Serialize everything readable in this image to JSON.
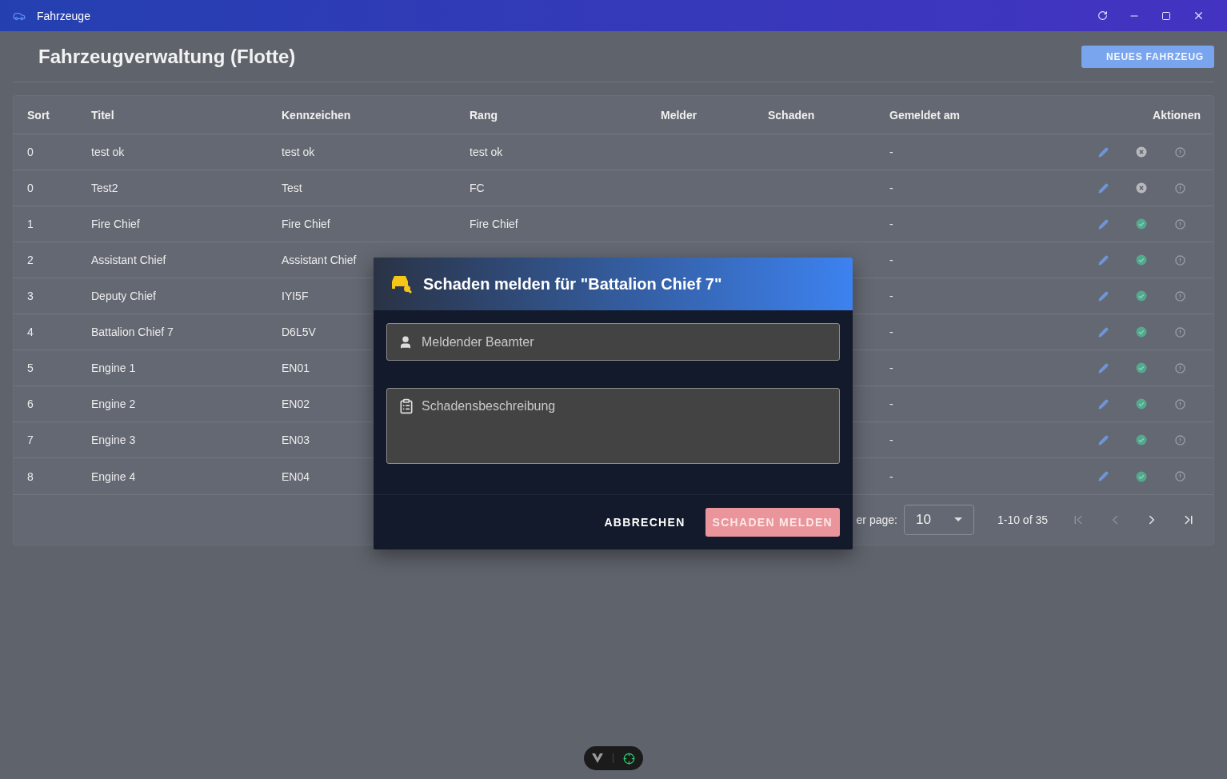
{
  "window": {
    "title": "Fahrzeuge"
  },
  "page": {
    "heading": "Fahrzeugverwaltung (Flotte)",
    "new_button": "NEUES FAHRZEUG"
  },
  "table": {
    "columns": [
      "Sort",
      "Titel",
      "Kennzeichen",
      "Rang",
      "Melder",
      "Schaden",
      "Gemeldet am",
      "Aktionen"
    ],
    "rows": [
      {
        "sort": "0",
        "titel": "test ok",
        "kennzeichen": "test ok",
        "rang": "test ok",
        "gemeldet_am": "-",
        "active": false
      },
      {
        "sort": "0",
        "titel": "Test2",
        "kennzeichen": "Test",
        "rang": "FC",
        "gemeldet_am": "-",
        "active": false
      },
      {
        "sort": "1",
        "titel": "Fire Chief",
        "kennzeichen": "Fire Chief",
        "rang": "Fire Chief",
        "gemeldet_am": "-",
        "active": true
      },
      {
        "sort": "2",
        "titel": "Assistant Chief",
        "kennzeichen": "Assistant Chief",
        "gemeldet_am": "-",
        "active": true
      },
      {
        "sort": "3",
        "titel": "Deputy Chief",
        "kennzeichen": "IYI5F",
        "gemeldet_am": "-",
        "active": true
      },
      {
        "sort": "4",
        "titel": "Battalion Chief 7",
        "kennzeichen": "D6L5V",
        "gemeldet_am": "-",
        "active": true
      },
      {
        "sort": "5",
        "titel": "Engine 1",
        "kennzeichen": "EN01",
        "gemeldet_am": "-",
        "active": true
      },
      {
        "sort": "6",
        "titel": "Engine 2",
        "kennzeichen": "EN02",
        "gemeldet_am": "-",
        "active": true
      },
      {
        "sort": "7",
        "titel": "Engine 3",
        "kennzeichen": "EN03",
        "gemeldet_am": "-",
        "active": true
      },
      {
        "sort": "8",
        "titel": "Engine 4",
        "kennzeichen": "EN04",
        "gemeldet_am": "-",
        "active": true
      }
    ]
  },
  "pagination": {
    "rows_per_page_label": "er page:",
    "rows_per_page": "10",
    "range": "1-10 of 35",
    "first_disabled": true,
    "prev_disabled": true,
    "next_disabled": false,
    "last_disabled": false
  },
  "dialog": {
    "title": "Schaden melden für \"Battalion Chief 7\"",
    "fields": [
      {
        "kind": "input",
        "placeholder": "Meldender Beamter"
      },
      {
        "kind": "textarea",
        "placeholder": "Schadensbeschreibung"
      }
    ],
    "buttons": [
      {
        "kind": "text",
        "label": "ABBRECHEN"
      },
      {
        "kind": "filled",
        "label": "SCHADEN MELDEN"
      }
    ]
  }
}
